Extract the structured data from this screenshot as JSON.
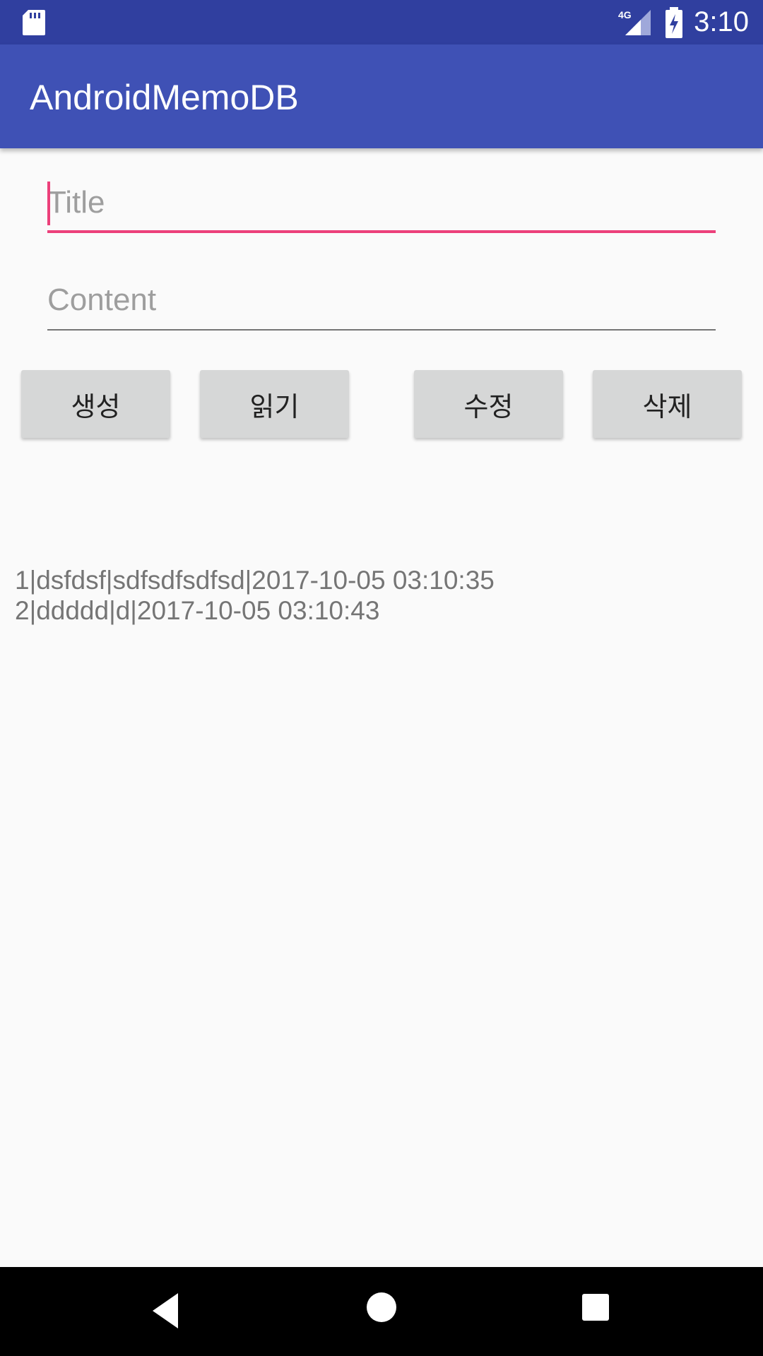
{
  "status_bar": {
    "time": "3:10",
    "network": "4G",
    "icons": [
      "sd-card-icon",
      "signal-icon",
      "battery-charging-icon"
    ]
  },
  "app_bar": {
    "title": "AndroidMemoDB"
  },
  "form": {
    "title_placeholder": "Title",
    "title_value": "",
    "content_placeholder": "Content",
    "content_value": ""
  },
  "buttons": {
    "create": "생성",
    "read": "읽기",
    "update": "수정",
    "delete": "삭제"
  },
  "results": [
    "1|dsfdsf|sdfsdfsdfsd|2017-10-05 03:10:35",
    "2|ddddd|d|2017-10-05 03:10:43"
  ],
  "nav_bar": {
    "icons": [
      "back-icon",
      "home-icon",
      "recents-icon"
    ]
  },
  "colors": {
    "status_bar": "#303f9f",
    "app_bar": "#3f51b5",
    "accent": "#ec407a",
    "button": "#d6d7d7"
  }
}
